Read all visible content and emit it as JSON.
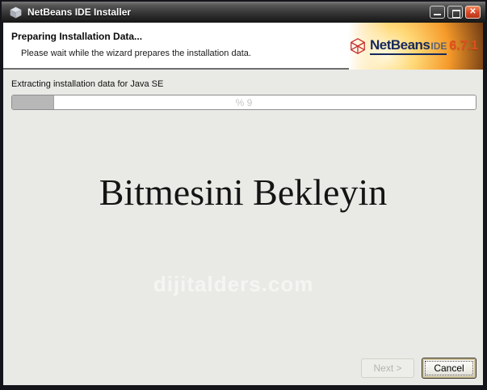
{
  "window": {
    "title": "NetBeans IDE Installer"
  },
  "header": {
    "title": "Preparing Installation Data...",
    "subtitle": "Please wait while the wizard prepares the installation data.",
    "logo": {
      "brand": "NetBeans",
      "product": "IDE",
      "version": "6.7.1"
    }
  },
  "progress": {
    "label": "Extracting installation data for Java SE",
    "value_text": "% 9",
    "percent": 9
  },
  "overlay": {
    "message": "Bitmesini Bekleyin",
    "watermark": "dijitalders.com"
  },
  "footer": {
    "next_label": "Next >",
    "cancel_label": "Cancel"
  },
  "colors": {
    "titlebar_top": "#7a7a7a",
    "titlebar_bottom": "#161616",
    "frame": "#14141b",
    "body_bg": "#e9e9e5",
    "header_bg": "#ffffff",
    "logo_orange": "#f59a2a",
    "logo_brand_navy": "#16295c",
    "logo_version_red": "#e04f20",
    "progress_fill": "#b7b7b7",
    "close_button_red": "#d84a2a"
  }
}
